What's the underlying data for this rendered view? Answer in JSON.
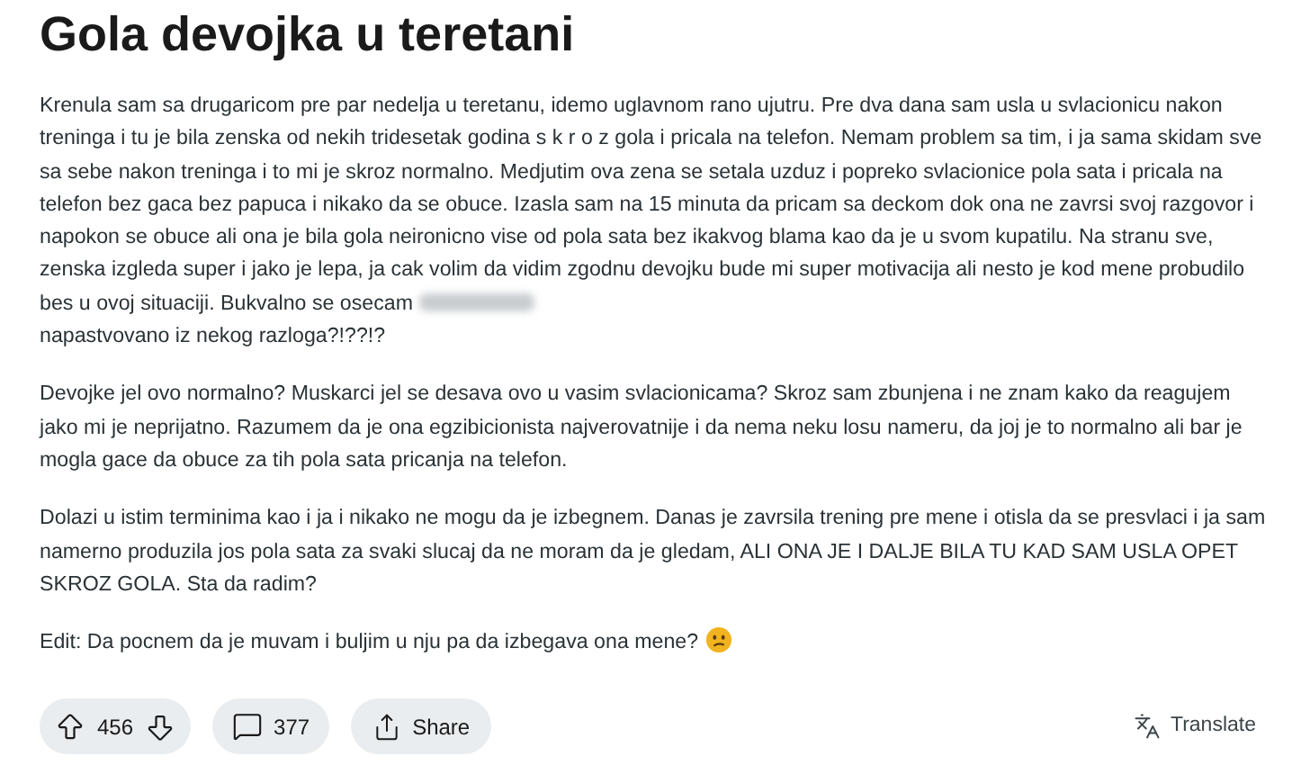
{
  "post": {
    "title": "Gola devojka u teretani",
    "paragraphs": [
      {
        "text": "Krenula sam sa drugaricom pre par nedelja u teretanu, idemo uglavnom rano ujutru. Pre dva dana sam usla u svlacionicu nakon treninga i tu je bila zenska od nekih tridesetak godina s k r o z gola i pricala na telefon. Nemam problem sa tim, i ja sama skidam sve sa sebe nakon treninga i to mi je skroz normalno. Medjutim ova zena se setala uzduz i popreko svlacionice pola sata i pricala na telefon bez gaca bez papuca i nikako da se obuce. Izasla sam na 15 minuta da pricam sa deckom dok ona ne zavrsi svoj razgovor i napokon se obuce ali ona je bila gola neironicno vise od pola sata bez ikakvog blama kao da je u svom kupatilu. Na stranu sve, zenska izgleda super i jako je lepa, ja cak volim da vidim zgodnu devojku bude mi super motivacija ali nesto je kod mene probudilo bes u ovoj situaciji. Bukvalno se osecam",
        "blurred": true,
        "text_after": "napastvovano iz nekog razloga?!??!?"
      },
      {
        "text": "Devojke jel ovo normalno? Muskarci jel se desava ovo u vasim svlacionicama? Skroz sam zbunjena i ne znam kako da reagujem jako mi je neprijatno. Razumem da je ona egzibicionista najverovatnije i da nema neku losu nameru, da joj je to normalno ali bar je mogla gace da obuce za tih pola sata pricanja na telefon.",
        "blurred": false
      },
      {
        "text": "Dolazi u istim terminima kao i ja i nikako ne mogu da je izbegnem. Danas je zavrsila trening pre mene i otisla da se presvlaci i ja sam namerno produzila jos pola sata za svaki slucaj da ne moram da je gledam, ALI ONA JE I DALJE BILA TU KAD SAM USLA OPET SKROZ GOLA. Sta da radim?",
        "blurred": false
      },
      {
        "text": "Edit: Da pocnem da je muvam i buljim u nju pa da izbegava ona mene?",
        "emoji": true
      }
    ],
    "votes": "456",
    "comments": "377",
    "share": "Share",
    "translate": "Translate"
  }
}
